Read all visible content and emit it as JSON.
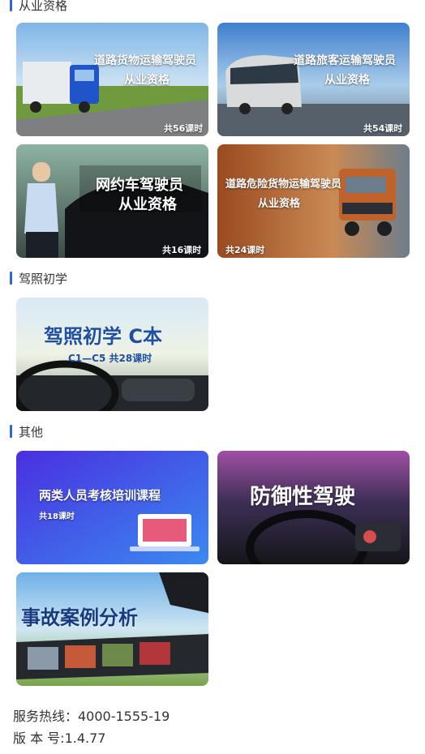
{
  "sections": [
    {
      "title": "从业资格",
      "cards": [
        {
          "line1": "道路货物运输驾驶员",
          "line2": "从业资格",
          "hours": "共56课时",
          "icon": "blue-truck-image"
        },
        {
          "line1": "道路旅客运输驾驶员",
          "line2": "从业资格",
          "hours": "共54课时",
          "icon": "coach-bus-image"
        },
        {
          "line1": "网约车驾驶员",
          "line2": "从业资格",
          "hours": "共16课时",
          "icon": "ride-hailing-driver-image"
        },
        {
          "line1": "道路危险货物运输驾驶员",
          "line2": "从业资格",
          "hours": "共24课时",
          "icon": "tanker-truck-image"
        }
      ]
    },
    {
      "title": "驾照初学",
      "cards": [
        {
          "line1": "驾照初学 C本",
          "line2": "C1—C5    共28课时",
          "icon": "steering-wheel-image"
        }
      ]
    },
    {
      "title": "其他",
      "cards": [
        {
          "line1": "两类人员考核培训课程",
          "line2": "共18课时",
          "icon": "training-laptop-image"
        },
        {
          "line1": "防御性驾驶",
          "icon": "dashboard-driving-image"
        },
        {
          "line1": "事故案例分析",
          "icon": "film-strip-accident-image"
        }
      ]
    }
  ],
  "footer": {
    "hotline": "服务热线：4000-1555-19",
    "version": "版 本 号:1.4.77"
  },
  "colors": {
    "accent": "#2c66d8",
    "purple": "#5b3be0"
  }
}
